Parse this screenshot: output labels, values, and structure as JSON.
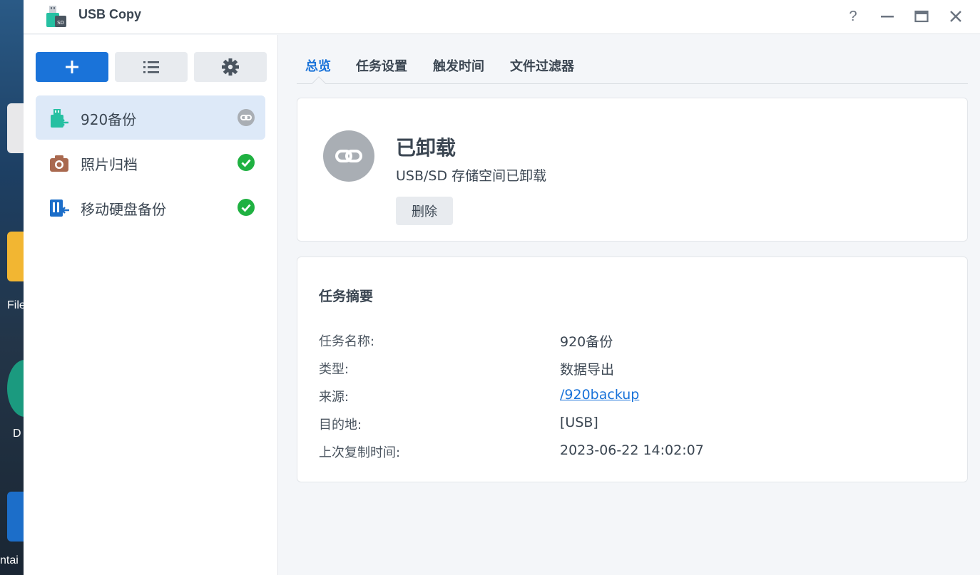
{
  "desktop": {
    "labels": [
      "File",
      "D",
      "ntai"
    ]
  },
  "window": {
    "title": "USB Copy",
    "help_glyph": "?",
    "minimize_glyph": "—",
    "maximize_glyph": "▭",
    "close_glyph": "✕"
  },
  "sidebar": {
    "tasks": [
      {
        "label": "920备份",
        "status": "unmounted-icon"
      },
      {
        "label": "照片归档",
        "status": "check-icon"
      },
      {
        "label": "移动硬盘备份",
        "status": "check-icon"
      }
    ]
  },
  "tabs": [
    {
      "label": "总览",
      "active": true
    },
    {
      "label": "任务设置"
    },
    {
      "label": "触发时间"
    },
    {
      "label": "文件过滤器"
    }
  ],
  "status": {
    "title": "已卸载",
    "subtitle": "USB/SD 存储空间已卸载",
    "delete_label": "删除"
  },
  "summary": {
    "title": "任务摘要",
    "rows": [
      {
        "key": "任务名称:",
        "value": "920备份"
      },
      {
        "key": "类型:",
        "value": "数据导出"
      },
      {
        "key": "来源:",
        "value": "/920backup"
      },
      {
        "key": "目的地:",
        "value": "[USB]"
      },
      {
        "key": "上次复制时间:",
        "value": "2023-06-22 14:02:07"
      }
    ]
  },
  "colors": {
    "accent": "#1a73d9",
    "success": "#1fb141",
    "unmounted": "#a9aeb4"
  }
}
